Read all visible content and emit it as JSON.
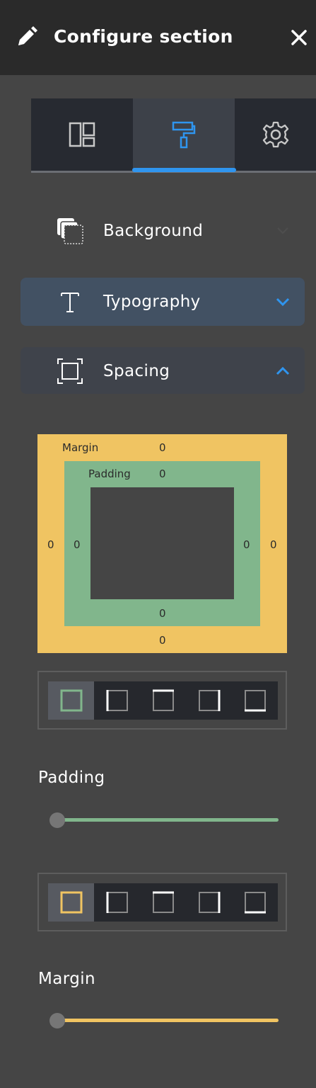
{
  "header": {
    "title": "Configure section",
    "icon": "pencil-icon",
    "close_icon": "close-icon"
  },
  "tabs": [
    {
      "icon": "layout-icon",
      "active": false
    },
    {
      "icon": "paint-roller-icon",
      "active": true
    },
    {
      "icon": "gear-icon",
      "active": false
    }
  ],
  "accordions": {
    "background": {
      "label": "Background",
      "icon": "background-layers-icon",
      "state": "collapsed"
    },
    "typography": {
      "label": "Typography",
      "icon": "text-icon",
      "state": "collapsed"
    },
    "spacing": {
      "label": "Spacing",
      "icon": "spacing-frame-icon",
      "state": "expanded"
    }
  },
  "box_model": {
    "margin_label": "Margin",
    "padding_label": "Padding",
    "margin": {
      "top": "0",
      "right": "0",
      "bottom": "0",
      "left": "0"
    },
    "padding": {
      "top": "0",
      "right": "0",
      "bottom": "0",
      "left": "0"
    }
  },
  "padding_control": {
    "label": "Padding",
    "sides": [
      "all-sides-icon",
      "left-side-icon",
      "top-side-icon",
      "right-side-icon",
      "bottom-side-icon"
    ],
    "selected_side": "all",
    "value": 0
  },
  "margin_control": {
    "label": "Margin",
    "sides": [
      "all-sides-icon",
      "left-side-icon",
      "top-side-icon",
      "right-side-icon",
      "bottom-side-icon"
    ],
    "selected_side": "all",
    "value": 0
  },
  "colors": {
    "accent_blue": "#2f95ef",
    "margin_yellow": "#f0c462",
    "padding_green": "#81b68c"
  }
}
